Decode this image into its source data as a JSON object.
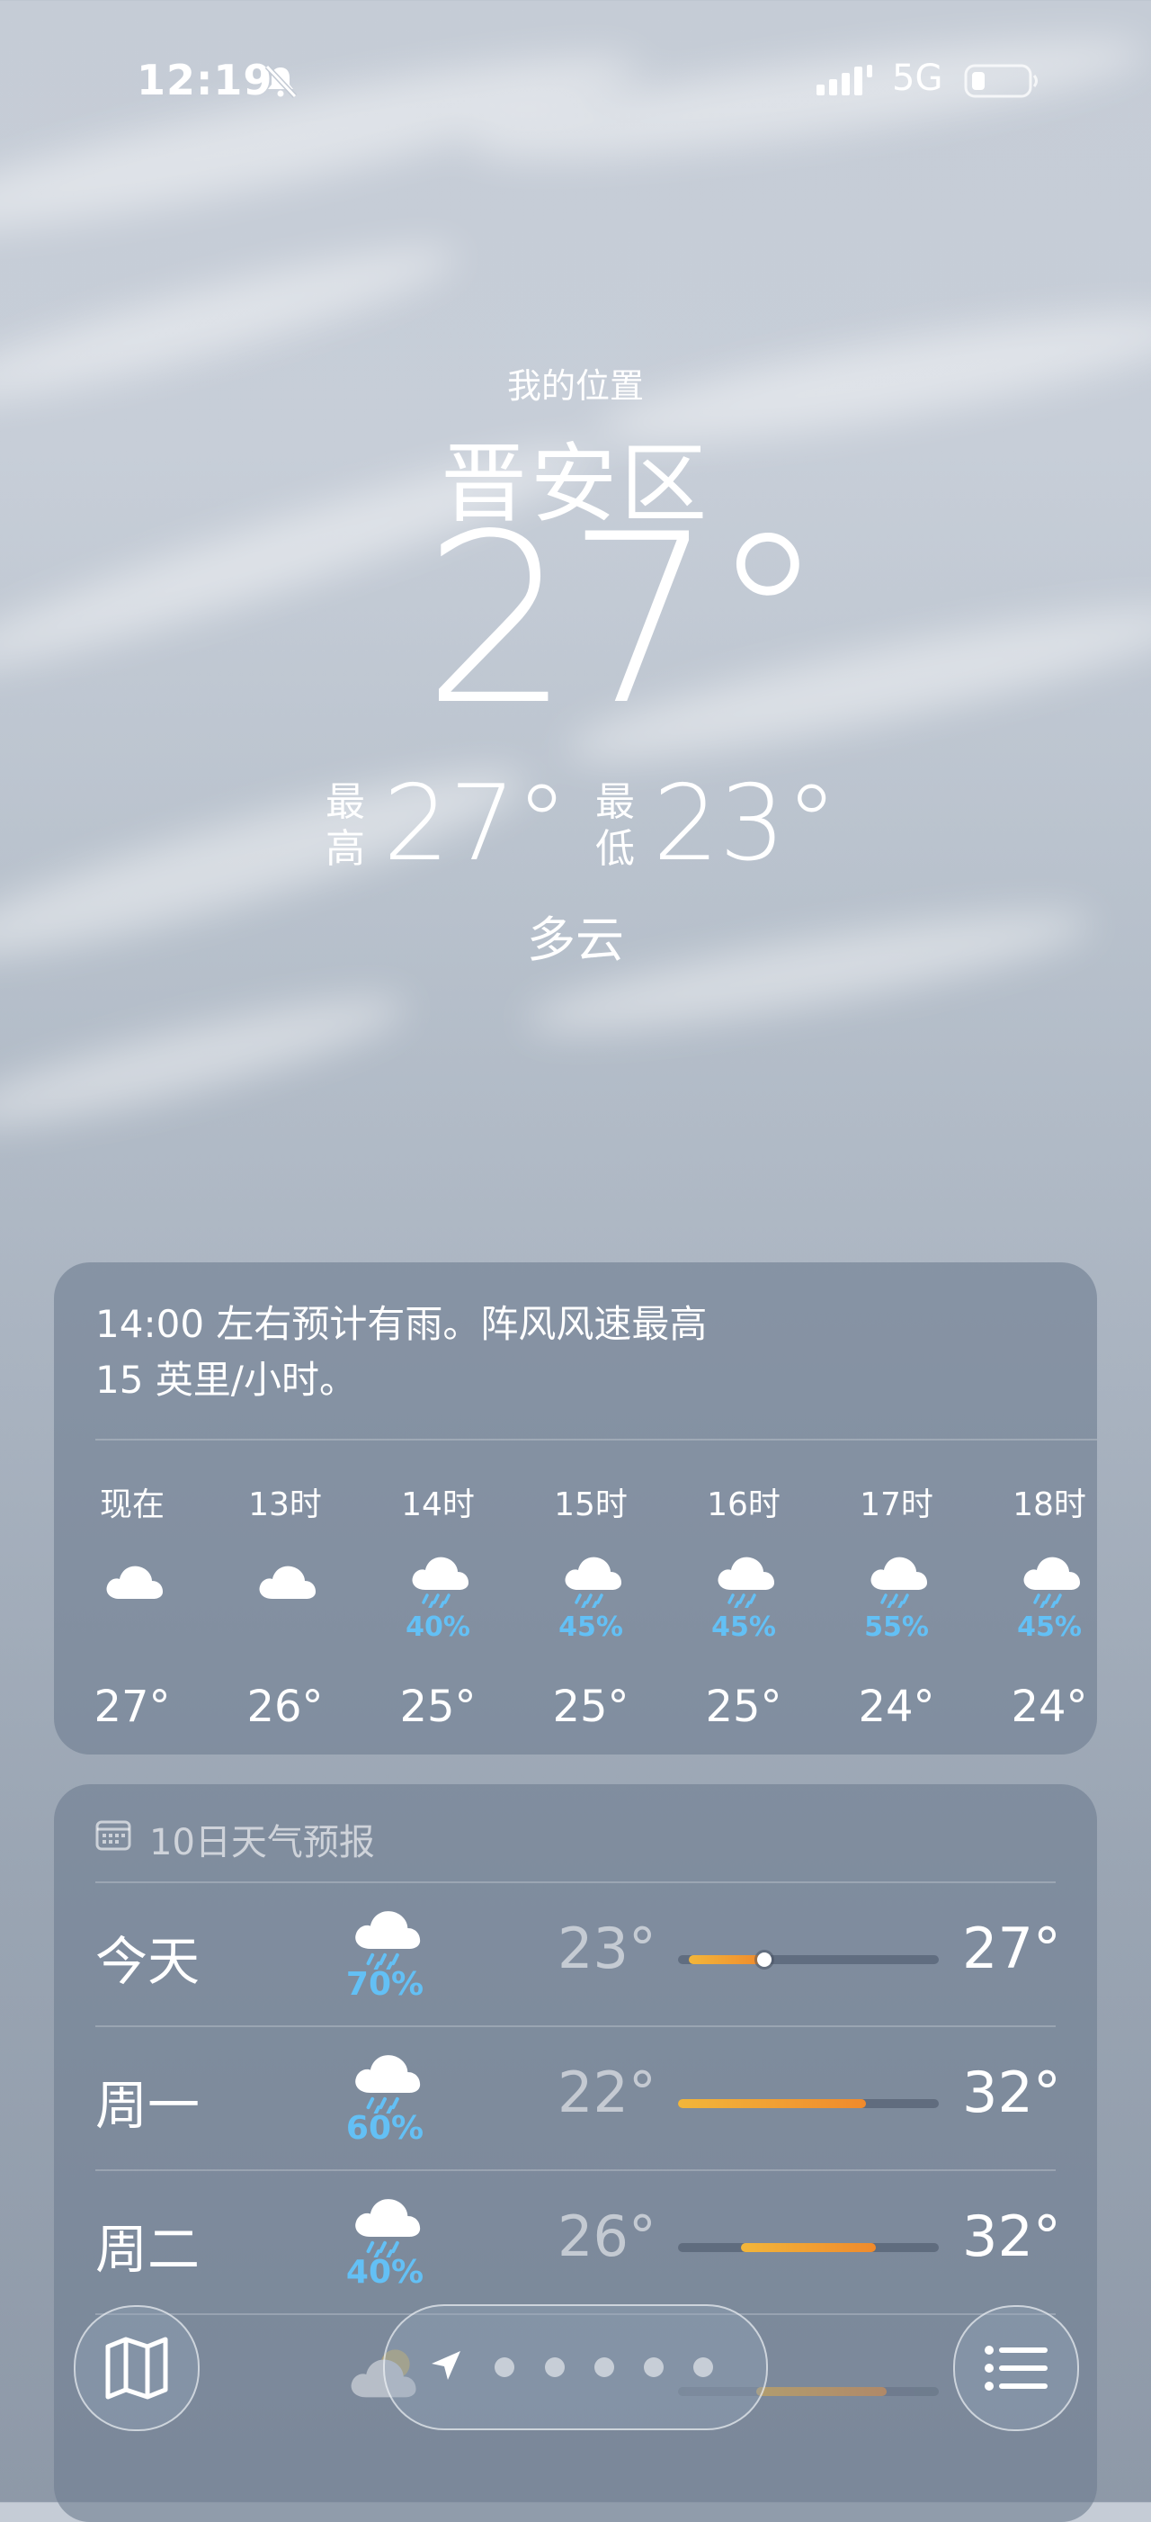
{
  "status_bar": {
    "time": "12:19",
    "network": "5G"
  },
  "header": {
    "location_label": "我的位置",
    "city": "晋安区",
    "current_temp": "27°",
    "high_label": "最高",
    "high": "27°",
    "low_label": "最低",
    "low": "23°",
    "condition": "多云"
  },
  "hourly_card": {
    "summary": "14:00 左右预计有雨。阵风风速最高\n15 英里/小时。",
    "hours": [
      {
        "label": "现在",
        "icon": "cloud-icon",
        "precip": "",
        "temp": "27°"
      },
      {
        "label": "13时",
        "icon": "cloud-icon",
        "precip": "",
        "temp": "26°"
      },
      {
        "label": "14时",
        "icon": "rain-cloud-icon",
        "precip": "40%",
        "temp": "25°"
      },
      {
        "label": "15时",
        "icon": "rain-cloud-icon",
        "precip": "45%",
        "temp": "25°"
      },
      {
        "label": "16时",
        "icon": "rain-cloud-icon",
        "precip": "45%",
        "temp": "25°"
      },
      {
        "label": "17时",
        "icon": "rain-cloud-icon",
        "precip": "55%",
        "temp": "24°"
      },
      {
        "label": "18时",
        "icon": "rain-cloud-icon",
        "precip": "45%",
        "temp": "24°"
      }
    ]
  },
  "daily_card": {
    "title": "10日天气预报",
    "days": [
      {
        "day": "今天",
        "icon": "rain-cloud-icon",
        "precip": "70%",
        "low": "23°",
        "high": "27°",
        "range_start": 0.04,
        "range_end": 0.33,
        "current": 0.33
      },
      {
        "day": "周一",
        "icon": "rain-cloud-icon",
        "precip": "60%",
        "low": "22°",
        "high": "32°",
        "range_start": 0.0,
        "range_end": 0.72
      },
      {
        "day": "周二",
        "icon": "rain-cloud-icon",
        "precip": "40%",
        "low": "26°",
        "high": "32°",
        "range_start": 0.24,
        "range_end": 0.76
      },
      {
        "day": "",
        "icon": "partly-sunny-icon",
        "precip": "",
        "low": "",
        "high": "",
        "range_start": 0.3,
        "range_end": 0.8
      }
    ]
  },
  "colors": {
    "precip": "#63c0f5",
    "bar_warm": "#f2b63a",
    "bar_hot": "#f08a2c"
  }
}
